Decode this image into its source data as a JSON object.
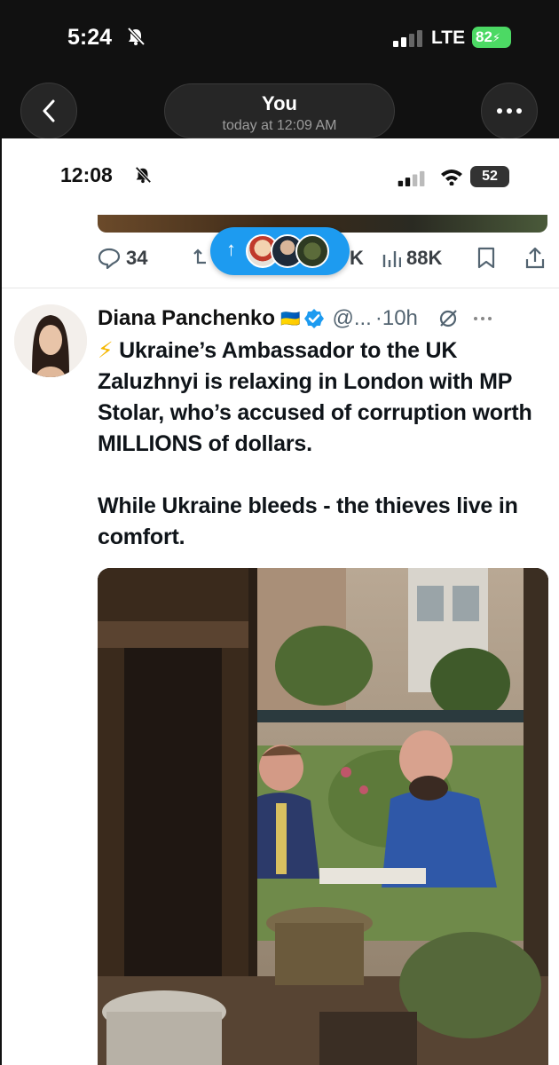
{
  "outer_status": {
    "time": "5:24",
    "network": "LTE",
    "battery": "82"
  },
  "outer_header": {
    "title": "You",
    "subtitle": "today at 12:09 AM"
  },
  "inner_status": {
    "time": "12:08",
    "battery": "52"
  },
  "actions": {
    "replies": "34",
    "views": "88K",
    "reposts_partial": "K"
  },
  "tweet": {
    "author_name": "Diana Panchenko",
    "flag": "🇺🇦",
    "handle": "@...",
    "time": "·10h",
    "paragraphs": [
      "Ukraine’s Ambassador to the UK Zaluzhnyi is relaxing in London with MP Stolar, who’s accused of corruption worth MILLIONS of dollars.",
      "While Ukraine bleeds - the thieves live in comfort."
    ]
  },
  "colors": {
    "twitter_blue": "#1d9bf0",
    "verified": "#1d9bf0",
    "battery_green": "#4cd964"
  }
}
